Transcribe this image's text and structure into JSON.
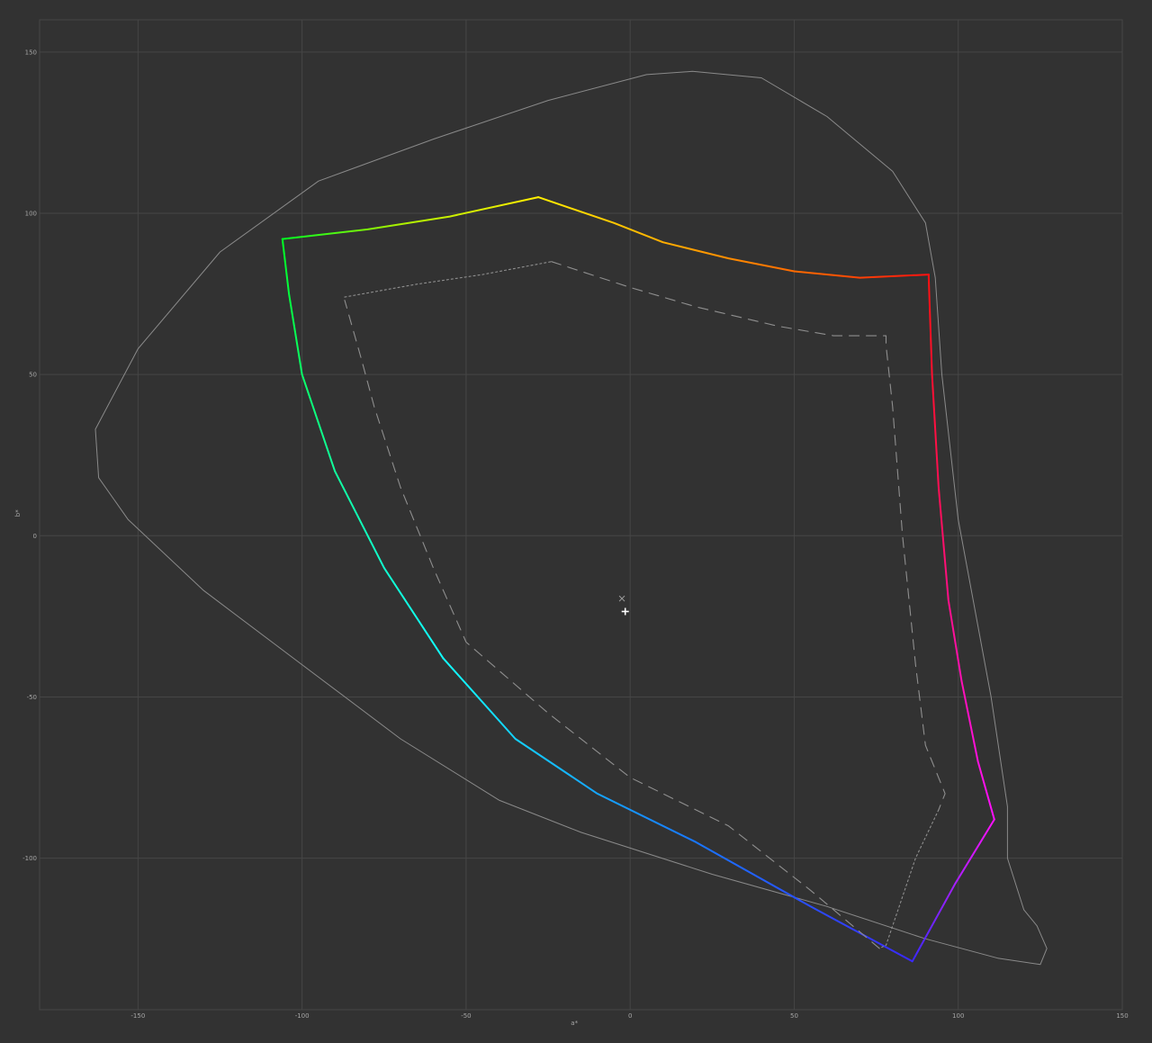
{
  "chart_data": {
    "type": "line",
    "title": "",
    "xlabel": "a*",
    "ylabel": "b*",
    "xlim": [
      -180,
      150
    ],
    "ylim": [
      -147,
      160
    ],
    "xticks": [
      -150,
      -100,
      -50,
      0,
      50,
      100,
      150
    ],
    "yticks": [
      150,
      100,
      50,
      0,
      -50,
      -100
    ],
    "grid": true,
    "colors": {
      "background": "#323232",
      "grid": "#464646",
      "tick_text": "#a6a6a6",
      "locus": "#8a8a8a",
      "inner_gamut": "#8f8f8f",
      "white_point": "#ffffff",
      "marker": "#9a9a9a"
    },
    "series": [
      {
        "role": "spectral-locus",
        "style": "thin",
        "points": [
          [
            19,
            144
          ],
          [
            5,
            143
          ],
          [
            -25,
            135
          ],
          [
            -60,
            123
          ],
          [
            -95,
            110
          ],
          [
            -125,
            88
          ],
          [
            -150,
            58
          ],
          [
            -163,
            33
          ],
          [
            -162,
            18
          ],
          [
            -153,
            5
          ],
          [
            -130,
            -17
          ],
          [
            -100,
            -40
          ],
          [
            -70,
            -63
          ],
          [
            -40,
            -82
          ],
          [
            -15,
            -92
          ],
          [
            25,
            -105
          ],
          [
            60,
            -115
          ],
          [
            90,
            -125
          ],
          [
            112,
            -131
          ],
          [
            125,
            -133
          ],
          [
            127,
            -128
          ],
          [
            124,
            -121
          ],
          [
            120,
            -116
          ],
          [
            115,
            -100
          ],
          [
            115,
            -84
          ],
          [
            110,
            -50
          ],
          [
            100,
            5
          ],
          [
            95,
            50
          ],
          [
            93,
            80
          ],
          [
            90,
            97
          ],
          [
            80,
            113
          ],
          [
            60,
            130
          ],
          [
            40,
            142
          ],
          [
            19,
            144
          ]
        ]
      },
      {
        "role": "outer-gamut-green-yellow",
        "colorStops": [
          [
            0,
            "#00ff22"
          ],
          [
            0.45,
            "#aaf000"
          ],
          [
            1,
            "#ffee00"
          ]
        ],
        "points": [
          [
            -106,
            92
          ],
          [
            -80,
            95
          ],
          [
            -55,
            99
          ],
          [
            -28,
            105
          ]
        ]
      },
      {
        "role": "outer-gamut-yellow-red",
        "colorStops": [
          [
            0,
            "#ffee00"
          ],
          [
            0.4,
            "#ffa000"
          ],
          [
            0.75,
            "#ff5a00"
          ],
          [
            1,
            "#ff1010"
          ]
        ],
        "points": [
          [
            -28,
            105
          ],
          [
            -5,
            97
          ],
          [
            10,
            91
          ],
          [
            30,
            86
          ],
          [
            50,
            82
          ],
          [
            70,
            80
          ],
          [
            91,
            81
          ]
        ]
      },
      {
        "role": "outer-gamut-red-magenta",
        "colorStops": [
          [
            0,
            "#ff1010"
          ],
          [
            0.45,
            "#ff0f5f"
          ],
          [
            1,
            "#ff10ff"
          ]
        ],
        "points": [
          [
            91,
            81
          ],
          [
            91,
            80
          ],
          [
            92,
            50
          ],
          [
            94,
            15
          ],
          [
            97,
            -20
          ],
          [
            101,
            -45
          ],
          [
            106,
            -70
          ],
          [
            111,
            -88
          ]
        ]
      },
      {
        "role": "outer-gamut-magenta-blue",
        "colorStops": [
          [
            0,
            "#ff10ff"
          ],
          [
            0.5,
            "#a020ff"
          ],
          [
            1,
            "#3a28ff"
          ]
        ],
        "points": [
          [
            111,
            -88
          ],
          [
            99,
            -108
          ],
          [
            86,
            -132
          ]
        ]
      },
      {
        "role": "outer-gamut-blue-cyan",
        "colorStops": [
          [
            0,
            "#3a28ff"
          ],
          [
            0.45,
            "#1878ff"
          ],
          [
            1,
            "#11ffff"
          ]
        ],
        "points": [
          [
            86,
            -132
          ],
          [
            55,
            -115
          ],
          [
            20,
            -95
          ],
          [
            -10,
            -80
          ],
          [
            -35,
            -63
          ],
          [
            -57,
            -38
          ]
        ]
      },
      {
        "role": "outer-gamut-cyan-green",
        "colorStops": [
          [
            0,
            "#11ffff"
          ],
          [
            0.5,
            "#11ff99"
          ],
          [
            1,
            "#00ff22"
          ]
        ],
        "points": [
          [
            -57,
            -38
          ],
          [
            -75,
            -10
          ],
          [
            -90,
            20
          ],
          [
            -100,
            50
          ],
          [
            -104,
            75
          ],
          [
            -106,
            92
          ]
        ]
      },
      {
        "role": "inner-gamut-dashed",
        "style": "dashed",
        "points": [
          [
            -24,
            85
          ],
          [
            -15,
            82
          ],
          [
            0,
            77
          ],
          [
            20,
            71
          ],
          [
            45,
            65
          ],
          [
            62,
            62
          ],
          [
            78,
            62
          ],
          [
            78,
            59
          ],
          [
            80,
            40
          ],
          [
            83,
            0
          ],
          [
            87,
            -40
          ],
          [
            90,
            -65
          ],
          [
            96,
            -80
          ],
          [
            94,
            -85
          ]
        ]
      },
      {
        "role": "inner-gamut-dotted",
        "style": "dotted",
        "points": [
          [
            94,
            -85
          ],
          [
            87,
            -100
          ],
          [
            82,
            -115
          ],
          [
            78,
            -127
          ],
          [
            76,
            -128
          ]
        ]
      },
      {
        "role": "inner-gamut-dashed",
        "style": "dashed",
        "points": [
          [
            76,
            -128
          ],
          [
            55,
            -110
          ],
          [
            30,
            -90
          ],
          [
            0,
            -75
          ],
          [
            -25,
            -55
          ],
          [
            -50,
            -33
          ],
          [
            -60,
            -10
          ],
          [
            -70,
            15
          ],
          [
            -78,
            40
          ],
          [
            -82,
            55
          ],
          [
            -87,
            73
          ]
        ]
      },
      {
        "role": "inner-gamut-dotted",
        "style": "dotted",
        "points": [
          [
            -87,
            74
          ],
          [
            -65,
            78
          ],
          [
            -45,
            81
          ],
          [
            -24,
            85
          ]
        ]
      }
    ],
    "markers": [
      {
        "name": "white-point-cross",
        "shape": "plus",
        "a": -1.5,
        "b": -23.5
      },
      {
        "name": "reference-x",
        "shape": "x",
        "a": -2.5,
        "b": -19.5
      }
    ]
  }
}
